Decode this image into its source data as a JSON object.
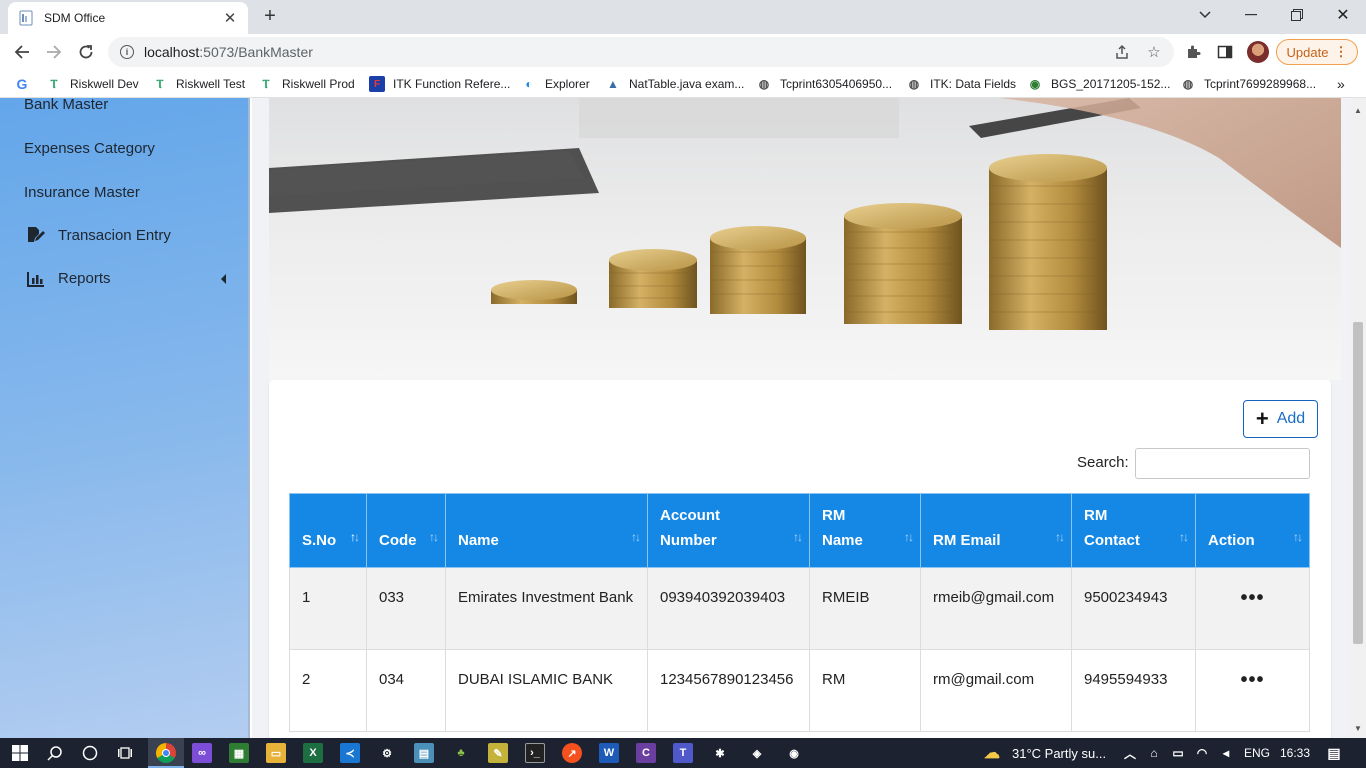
{
  "browser": {
    "tab_title": "SDM Office",
    "url_host": "localhost",
    "url_rest": ":5073/BankMaster",
    "update_label": "Update",
    "bookmarks": [
      {
        "label": "Riskwell Dev",
        "icon": "riskwell-icon"
      },
      {
        "label": "Riskwell Test",
        "icon": "riskwell-icon"
      },
      {
        "label": "Riskwell Prod",
        "icon": "riskwell-icon"
      },
      {
        "label": "ITK Function Refere...",
        "icon": "itk-icon"
      },
      {
        "label": "Explorer",
        "icon": "explorer-icon"
      },
      {
        "label": "NatTable.java exam...",
        "icon": "nattable-icon"
      },
      {
        "label": "Tcprint6305406950...",
        "icon": "globe-icon"
      },
      {
        "label": "ITK: Data Fields",
        "icon": "globe-icon"
      },
      {
        "label": "BGS_20171205-152...",
        "icon": "bgs-icon"
      },
      {
        "label": "Tcprint7699289968...",
        "icon": "globe-icon"
      }
    ]
  },
  "sidebar": {
    "items": [
      {
        "label": "Bank Master"
      },
      {
        "label": "Expenses Category"
      },
      {
        "label": "Insurance Master"
      },
      {
        "label": "Transacion Entry",
        "icon": "edit-document-icon"
      },
      {
        "label": "Reports",
        "icon": "bar-chart-icon"
      }
    ]
  },
  "page": {
    "add_label": "Add",
    "search_label": "Search:",
    "search_value": ""
  },
  "table": {
    "headers": [
      {
        "label": "S.No",
        "sorted": "asc"
      },
      {
        "label": "Code"
      },
      {
        "label": "Name"
      },
      {
        "label": "Account Number"
      },
      {
        "label": "RM Name"
      },
      {
        "label": "RM Email"
      },
      {
        "label": "RM Contact"
      },
      {
        "label": "Action"
      }
    ],
    "rows": [
      [
        "1",
        "033",
        "Emirates Investment Bank",
        "093940392039403",
        "RMEIB",
        "rmeib@gmail.com",
        "9500234943"
      ],
      [
        "2",
        "034",
        "DUBAI ISLAMIC BANK",
        "1234567890123456",
        "RM",
        "rm@gmail.com",
        "9495594933"
      ]
    ],
    "action_glyph": "•••"
  },
  "taskbar": {
    "weather": "31°C  Partly su...",
    "language": "ENG",
    "time": "16:33"
  }
}
